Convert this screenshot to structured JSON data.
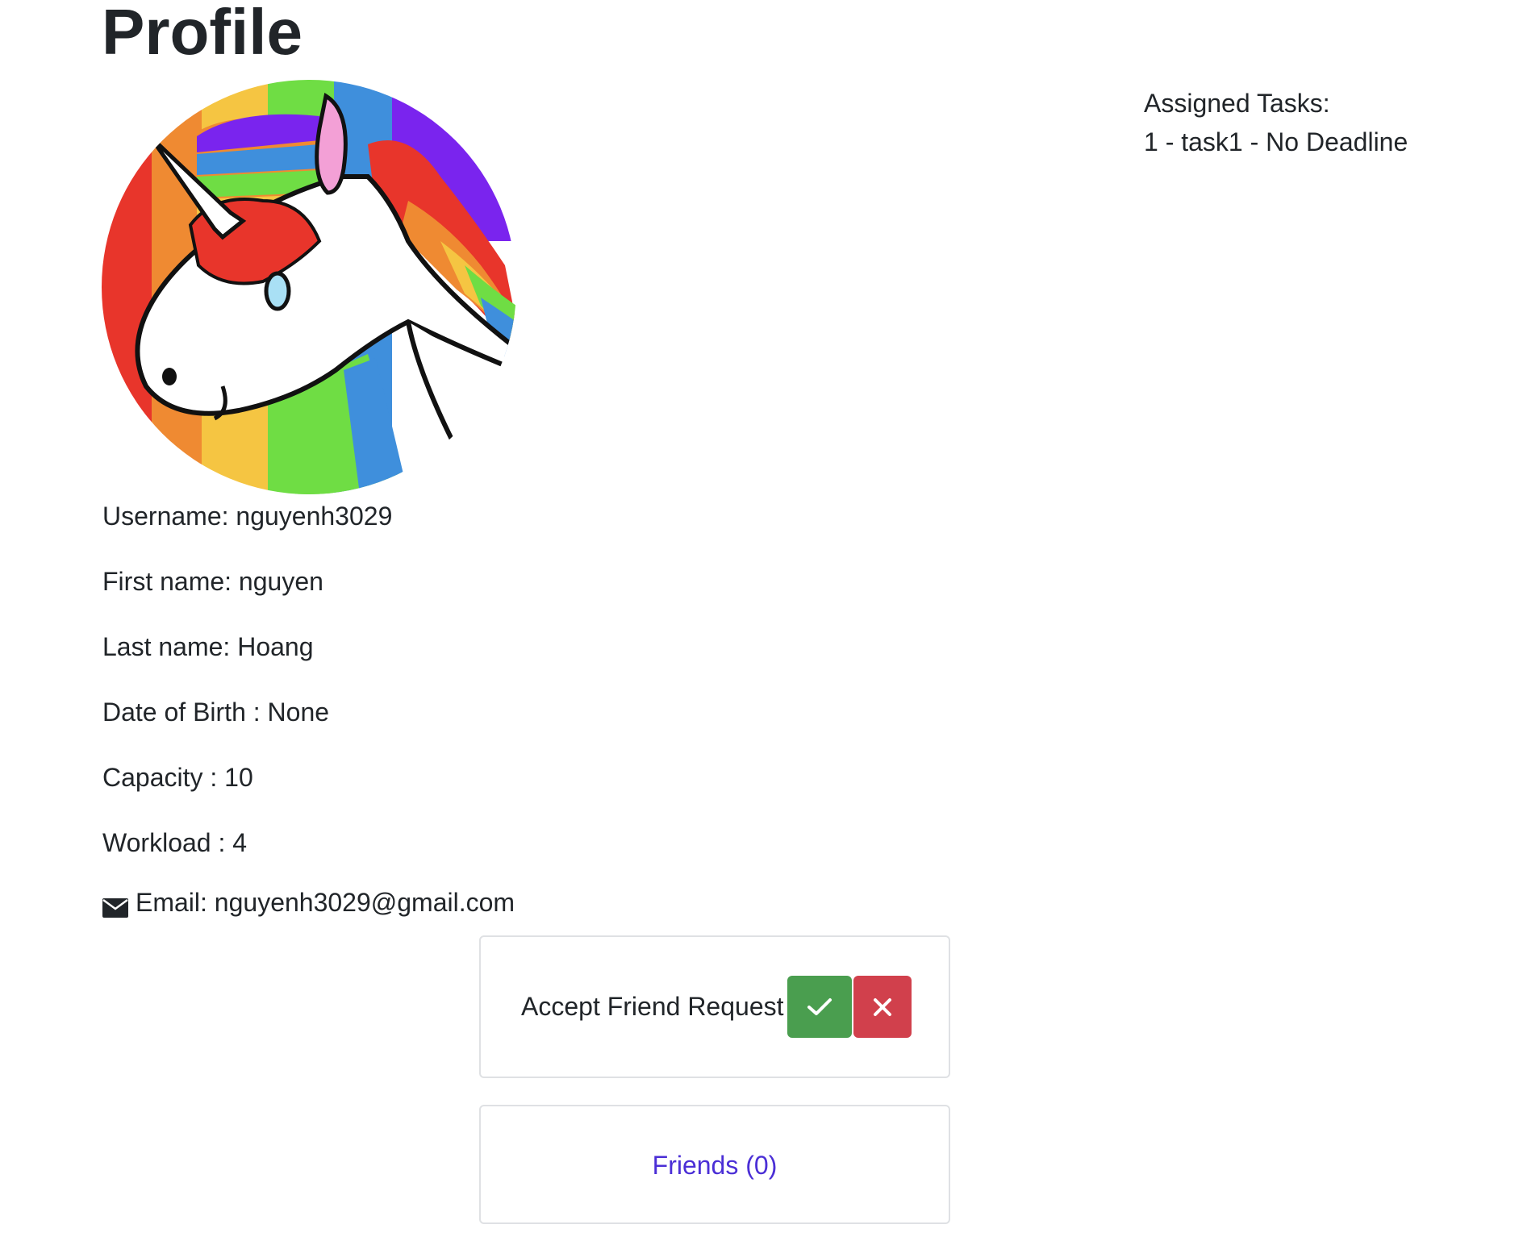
{
  "page": {
    "title": "Profile"
  },
  "avatar": {
    "icon": "unicorn-avatar",
    "stripe_colors": [
      "#e8352b",
      "#ef8a32",
      "#f5c542",
      "#6fdd44",
      "#3f8fdc",
      "#7a24ee"
    ]
  },
  "profile": {
    "username": "Username: nguyenh3029",
    "first_name": "First name: nguyen",
    "last_name": "Last name: Hoang",
    "dob": "Date of Birth : None",
    "capacity": "Capacity : 10",
    "workload": "Workload : 4",
    "email": "Email: nguyenh3029@gmail.com",
    "email_icon": "envelope-icon"
  },
  "tasks": {
    "heading": "Assigned Tasks:",
    "items": [
      "1 - task1 - No Deadline"
    ]
  },
  "friend_request": {
    "label": "Accept Friend Request",
    "accept_icon": "check-icon",
    "reject_icon": "close-icon",
    "accept_color": "#4a9e4f",
    "reject_color": "#d1404c"
  },
  "friends": {
    "label": "Friends (0)",
    "link_color": "#4b2fd6"
  }
}
